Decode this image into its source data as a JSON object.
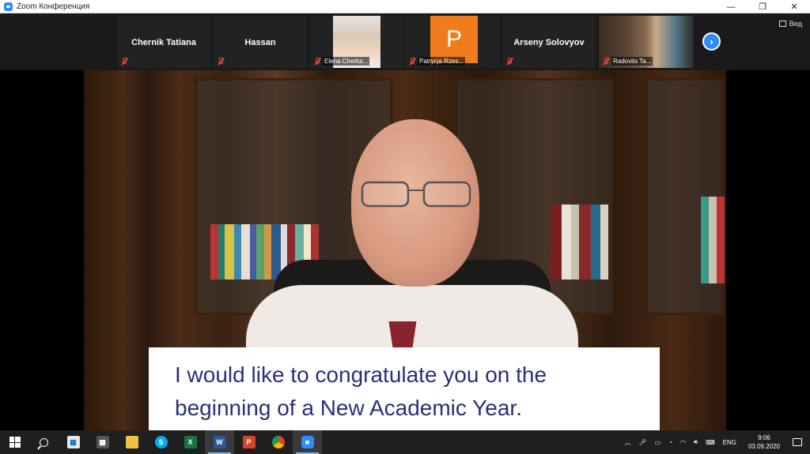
{
  "window": {
    "title": "Zoom Конференция"
  },
  "participants": [
    {
      "name": "Chernik Tatiana",
      "display": "name"
    },
    {
      "name": "Hassan",
      "display": "name"
    },
    {
      "name": "Elena Cherka...",
      "display": "photo"
    },
    {
      "name": "Patrycja Rzes...",
      "display": "avatar",
      "initial": "P"
    },
    {
      "name": "Arseny Solovyov",
      "display": "name"
    },
    {
      "name": "Radovits Ta...",
      "display": "photo"
    }
  ],
  "view_label": "Вид",
  "caption": {
    "line1": "I would like to congratulate you on the",
    "line2": "beginning of a New Academic Year."
  },
  "taskbar": {
    "apps": [
      "start",
      "search",
      "store",
      "calculator",
      "file-explorer",
      "skype",
      "excel",
      "word",
      "powerpoint",
      "chrome",
      "zoom"
    ],
    "language": "ENG",
    "time": "9:06",
    "date": "03.09.2020"
  },
  "colors": {
    "zoom_blue": "#2d8cff",
    "avatar_orange": "#f07d1c",
    "caption_text": "#2a2f7a",
    "mute_red": "#e54545"
  }
}
